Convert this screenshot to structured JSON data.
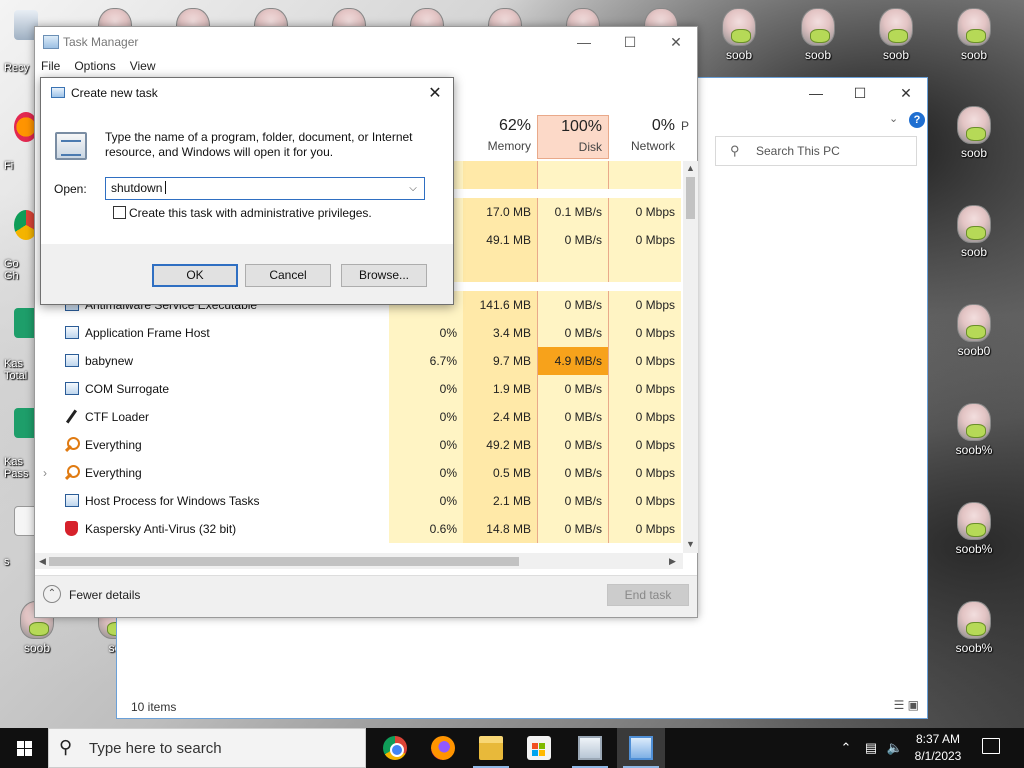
{
  "desktop": {
    "icons_top": [
      "",
      "",
      "",
      "",
      "",
      "",
      "",
      "",
      "",
      "soob",
      "soob",
      "soob",
      "soob"
    ],
    "icons_right": [
      "soob",
      "soob",
      "soob0",
      "soob%",
      "soob%",
      "soob%"
    ],
    "icons_bottom": [
      "soob",
      "so"
    ],
    "left_labels": [
      "Recy",
      "Fi",
      "Go\nGh",
      "Kas\nTotal",
      "Kas\nPass",
      "s"
    ]
  },
  "explorer": {
    "search_placeholder": "Search This PC",
    "status_items": "10 items",
    "help_glyph": "?"
  },
  "task_manager": {
    "title": "Task Manager",
    "menu": [
      "File",
      "Options",
      "View"
    ],
    "headers": {
      "cpu": {
        "pct": "",
        "name": ""
      },
      "memory": {
        "pct": "62%",
        "name": "Memory"
      },
      "disk": {
        "pct": "100%",
        "name": "Disk"
      },
      "network": {
        "pct": "0%",
        "name": "Network"
      },
      "power": {
        "pct": "",
        "name": "P"
      }
    },
    "partial_rows": [
      {
        "memory": "17.0 MB",
        "disk": "0.1 MB/s",
        "network": "0 Mbps"
      },
      {
        "memory": "49.1 MB",
        "disk": "0 MB/s",
        "network": "0 Mbps"
      }
    ],
    "rows": [
      {
        "name": "Antimalware Service Executable",
        "icon": "app-window-icon",
        "cpu": "",
        "memory": "141.6 MB",
        "disk": "0 MB/s",
        "network": "0 Mbps",
        "hot": false
      },
      {
        "name": "Application Frame Host",
        "icon": "app-window-icon",
        "cpu": "0%",
        "memory": "3.4 MB",
        "disk": "0 MB/s",
        "network": "0 Mbps",
        "hot": false
      },
      {
        "name": "babynew",
        "icon": "app-window-icon",
        "cpu": "6.7%",
        "memory": "9.7 MB",
        "disk": "4.9 MB/s",
        "network": "0 Mbps",
        "hot": true
      },
      {
        "name": "COM Surrogate",
        "icon": "app-window-icon",
        "cpu": "0%",
        "memory": "1.9 MB",
        "disk": "0 MB/s",
        "network": "0 Mbps",
        "hot": false
      },
      {
        "name": "CTF Loader",
        "icon": "pen-icon",
        "cpu": "0%",
        "memory": "2.4 MB",
        "disk": "0 MB/s",
        "network": "0 Mbps",
        "hot": false
      },
      {
        "name": "Everything",
        "icon": "magnifier-icon",
        "cpu": "0%",
        "memory": "49.2 MB",
        "disk": "0 MB/s",
        "network": "0 Mbps",
        "hot": false
      },
      {
        "name": "Everything",
        "icon": "magnifier-icon",
        "cpu": "0%",
        "memory": "0.5 MB",
        "disk": "0 MB/s",
        "network": "0 Mbps",
        "hot": false,
        "expander": "›"
      },
      {
        "name": "Host Process for Windows Tasks",
        "icon": "app-window-icon",
        "cpu": "0%",
        "memory": "2.1 MB",
        "disk": "0 MB/s",
        "network": "0 Mbps",
        "hot": false
      },
      {
        "name": "Kaspersky Anti-Virus (32 bit)",
        "icon": "shield-icon",
        "cpu": "0.6%",
        "memory": "14.8 MB",
        "disk": "0 MB/s",
        "network": "0 Mbps",
        "hot": false
      }
    ],
    "fewer_details": "Fewer details",
    "end_task": "End task"
  },
  "run_dialog": {
    "title": "Create new task",
    "description": "Type the name of a program, folder, document, or Internet resource, and Windows will open it for you.",
    "open_label": "Open:",
    "open_value": "shutdown",
    "admin_checkbox_label": "Create this task with administrative privileges.",
    "admin_checked": false,
    "ok": "OK",
    "cancel": "Cancel",
    "browse": "Browse..."
  },
  "taskbar": {
    "search_placeholder": "Type here to search",
    "apps": [
      "chrome-icon",
      "firefox-icon",
      "file-explorer-icon",
      "store-icon",
      "task-manager-icon",
      "run-icon"
    ],
    "time": "8:37 AM",
    "date": "8/1/2023"
  }
}
